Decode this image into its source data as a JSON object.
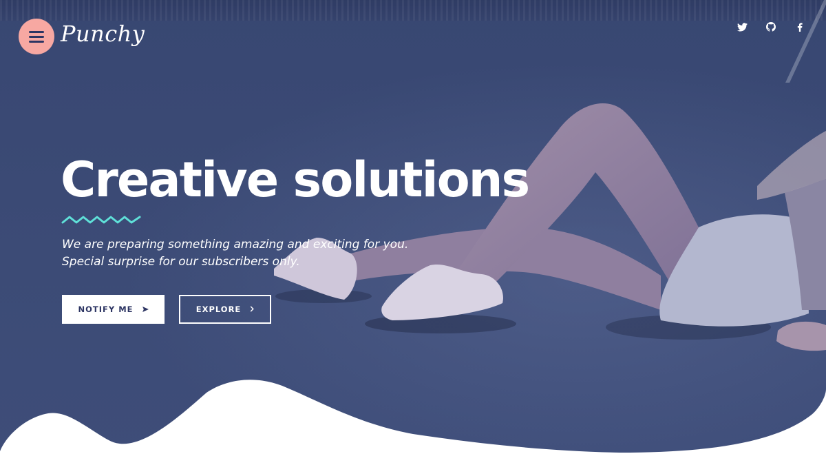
{
  "brand": {
    "logo_text": "Punchy"
  },
  "header": {
    "menu_icon": "hamburger-menu-icon",
    "social": [
      {
        "name": "twitter",
        "icon": "twitter-icon"
      },
      {
        "name": "github",
        "icon": "github-icon"
      },
      {
        "name": "facebook",
        "icon": "facebook-icon"
      }
    ]
  },
  "hero": {
    "title": "Creative solutions",
    "subtitle_line1": "We are preparing something amazing and exciting for you.",
    "subtitle_line2": "Special surprise for our subscribers only.",
    "buttons": {
      "notify_label": "NOTIFY ME",
      "notify_icon": "send-arrow-icon",
      "explore_label": "EXPLORE",
      "explore_icon": "chevron-right-icon"
    }
  },
  "colors": {
    "overlay": "#3f4d78",
    "menu_button": "#f7a8a2",
    "accent_zigzag": "#5fe0d8",
    "text": "#ffffff",
    "button_text_dark": "#2d3563"
  }
}
